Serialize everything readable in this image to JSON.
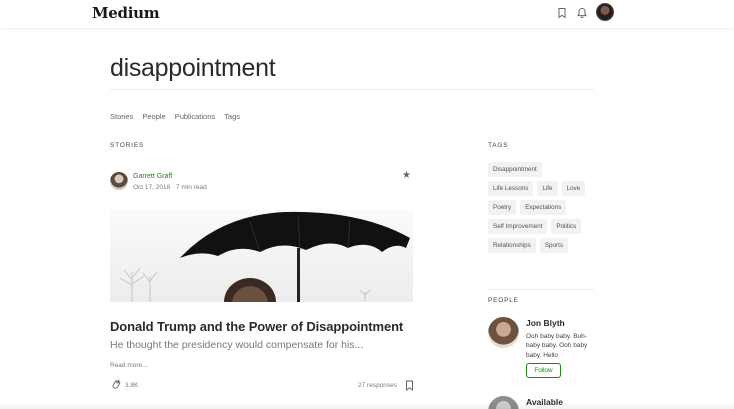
{
  "app": {
    "logo": "Medium"
  },
  "header": {
    "icons": [
      "bookmark-icon",
      "bell-icon",
      "avatar"
    ]
  },
  "page": {
    "title": "disappointment"
  },
  "subnav": [
    "Stories",
    "People",
    "Publications",
    "Tags"
  ],
  "sections": {
    "stories": "STORIES",
    "tags": "TAGS",
    "people": "PEOPLE"
  },
  "story": {
    "author": "Garrett Graff",
    "meta": "Oct 17, 2018 · 7 min read",
    "title": "Donald Trump and the Power of Disappointment",
    "subtitle": "He thought the presidency would compensate for his...",
    "read_more": "Read more...",
    "claps": "3.8K",
    "responses": "27 responses"
  },
  "tags": [
    [
      "Disappointment"
    ],
    [
      "Life Lessons",
      "Life",
      "Love"
    ],
    [
      "Poetry",
      "Expectations"
    ],
    [
      "Self Improvement",
      "Politics"
    ],
    [
      "Relationships",
      "Sports"
    ]
  ],
  "people": [
    {
      "name": "Jon Blyth",
      "bio": "Ooh baby baby. Buh-baby baby. Ooh baby baby. Hello",
      "follow": "Follow"
    },
    {
      "name": "Available"
    }
  ],
  "colors": {
    "accent": "#1a8917",
    "tag_bg": "#f2f2f2"
  }
}
